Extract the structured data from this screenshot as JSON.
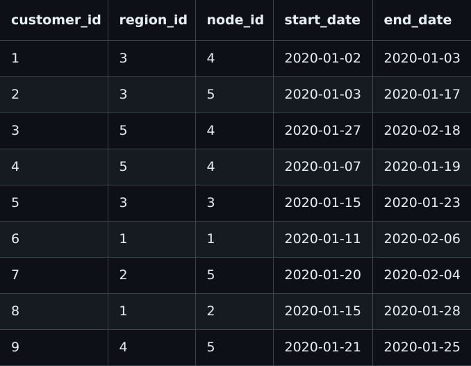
{
  "table": {
    "columns": [
      "customer_id",
      "region_id",
      "node_id",
      "start_date",
      "end_date"
    ],
    "rows": [
      [
        "1",
        "3",
        "4",
        "2020-01-02",
        "2020-01-03"
      ],
      [
        "2",
        "3",
        "5",
        "2020-01-03",
        "2020-01-17"
      ],
      [
        "3",
        "5",
        "4",
        "2020-01-27",
        "2020-02-18"
      ],
      [
        "4",
        "5",
        "4",
        "2020-01-07",
        "2020-01-19"
      ],
      [
        "5",
        "3",
        "3",
        "2020-01-15",
        "2020-01-23"
      ],
      [
        "6",
        "1",
        "1",
        "2020-01-11",
        "2020-02-06"
      ],
      [
        "7",
        "2",
        "5",
        "2020-01-20",
        "2020-02-04"
      ],
      [
        "8",
        "1",
        "2",
        "2020-01-15",
        "2020-01-28"
      ],
      [
        "9",
        "4",
        "5",
        "2020-01-21",
        "2020-01-25"
      ]
    ]
  },
  "colors": {
    "background": "#0d1117",
    "row_alt": "#161b22",
    "border": "#3d444d",
    "text": "#e6edf3"
  }
}
